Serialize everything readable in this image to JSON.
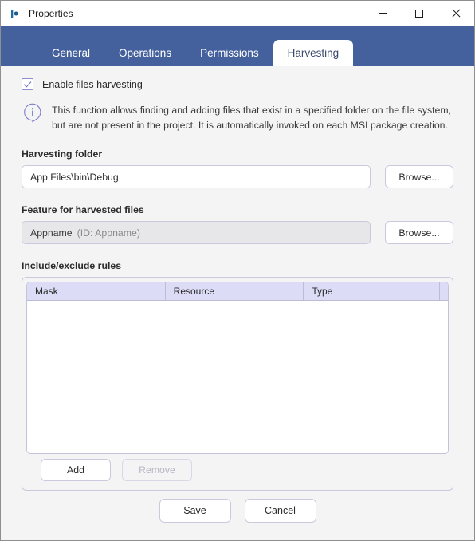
{
  "window": {
    "title": "Properties",
    "icon": "app-logo-icon",
    "controls": {
      "minimize": "minimize-icon",
      "maximize": "maximize-icon",
      "close": "close-icon"
    }
  },
  "tabs": [
    {
      "label": "General",
      "active": false
    },
    {
      "label": "Operations",
      "active": false
    },
    {
      "label": "Permissions",
      "active": false
    },
    {
      "label": "Harvesting",
      "active": true
    }
  ],
  "harvesting": {
    "enable_checkbox": {
      "label": "Enable files harvesting",
      "checked": true
    },
    "info": {
      "icon": "info-icon",
      "text": "This function allows finding and adding files that exist in a specified folder on the file system, but are not present in the project. It is automatically invoked on each MSI package creation."
    },
    "folder_field": {
      "label": "Harvesting folder",
      "value": "App Files\\bin\\Debug",
      "placeholder": "",
      "browse_label": "Browse..."
    },
    "feature_field": {
      "label": "Feature for harvested files",
      "value": "Appname",
      "value_id": "(ID: Appname)",
      "disabled": true,
      "browse_label": "Browse..."
    },
    "rules": {
      "label": "Include/exclude rules",
      "columns": [
        "Mask",
        "Resource",
        "Type",
        ""
      ],
      "rows": [],
      "add_label": "Add",
      "remove_label": "Remove",
      "remove_disabled": true
    }
  },
  "footer": {
    "save_label": "Save",
    "cancel_label": "Cancel"
  },
  "colors": {
    "tabstrip": "#45619d",
    "accent": "#6b6bc4",
    "table_header": "#dcdcf6",
    "panel_bg": "#f4f4f4"
  }
}
